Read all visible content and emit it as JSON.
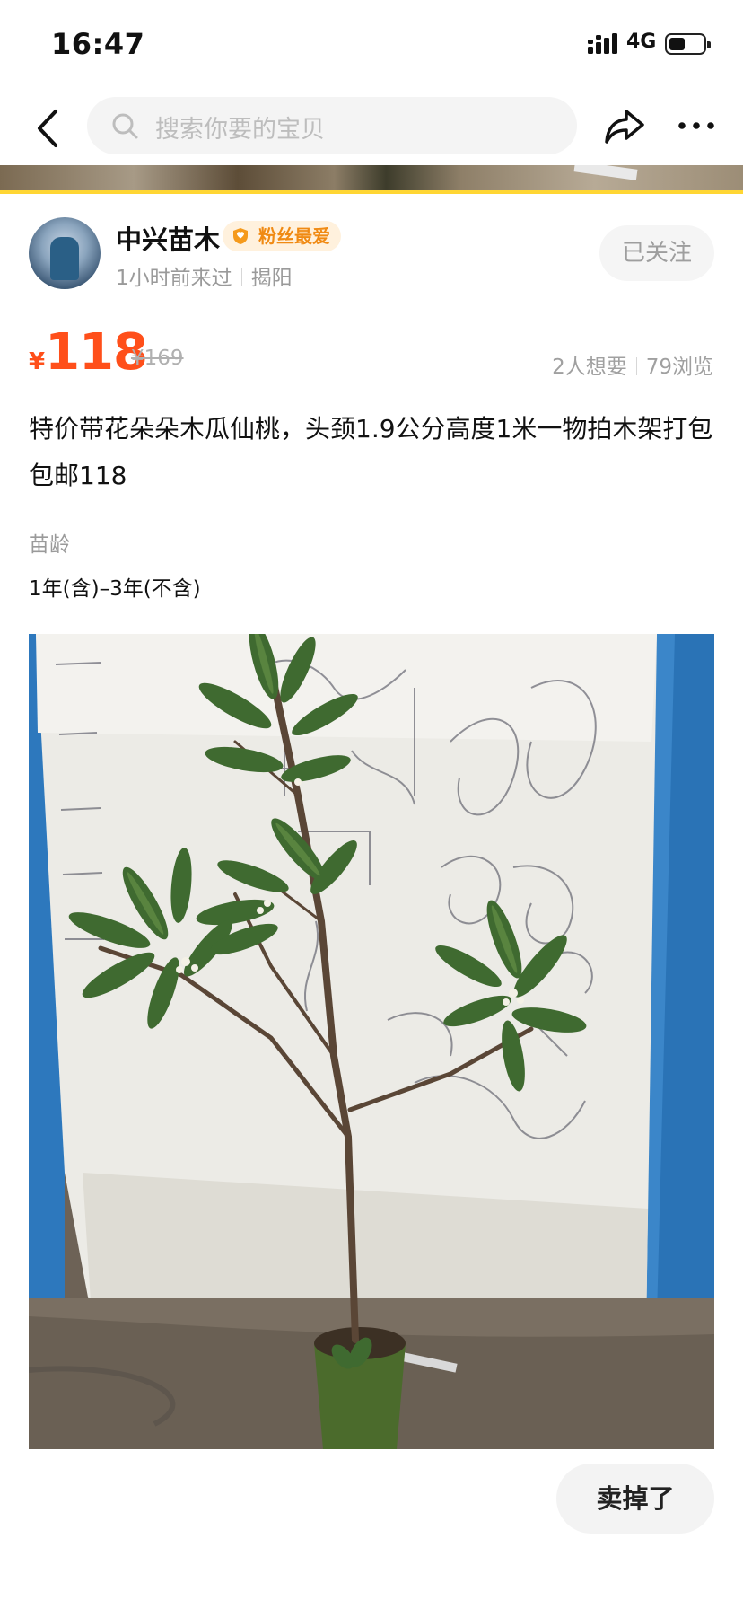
{
  "status_bar": {
    "time": "16:47",
    "network": "4G"
  },
  "nav": {
    "search_placeholder": "搜索你要的宝贝"
  },
  "seller": {
    "name": "中兴苗木",
    "badge": "粉丝最爱",
    "last_seen": "1小时前来过",
    "location": "揭阳",
    "follow_label": "已关注"
  },
  "price": {
    "currency": "¥",
    "value": "118",
    "original": "¥169"
  },
  "stats": {
    "wants": "2人想要",
    "views": "79浏览"
  },
  "title": "特价带花朵朵木瓜仙桃，头颈1.9公分高度1米一物拍木架打包包邮118",
  "attributes": {
    "label": "苗龄",
    "value": "1年(含)–3年(不含)"
  },
  "actions": {
    "sold_label": "卖掉了"
  },
  "colors": {
    "accent_price": "#ff4f1a",
    "badge_orange": "#f08a13",
    "strip_yellow": "#ffd633"
  },
  "icons": [
    "back-arrow-icon",
    "search-icon",
    "share-icon",
    "more-icon",
    "signal-icon",
    "battery-icon",
    "fan-badge-icon"
  ]
}
